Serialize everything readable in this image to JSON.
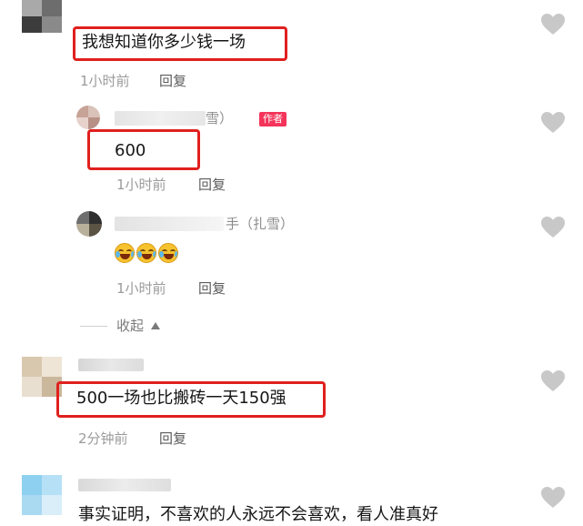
{
  "colors": {
    "highlight_box": "#e0201e",
    "author_badge": "#f4345a",
    "heart": "#c8c8c8",
    "meta_text": "#9b9b9b"
  },
  "comments": [
    {
      "text": "我想知道你多少钱一场",
      "time": "1小时前",
      "reply_label": "回复"
    },
    {
      "name_visible": "雪）",
      "author_badge": "作者",
      "text": "600",
      "time": "1小时前",
      "reply_label": "回复"
    },
    {
      "name_visible": "手（扎雪）",
      "emoji_text": "🤣🤣🤣",
      "time": "1小时前",
      "reply_label": "回复"
    },
    {
      "text": "500一场也比搬砖一天150强",
      "time": "2分钟前",
      "reply_label": "回复"
    },
    {
      "text": "事实证明，不喜欢的人永远不会喜欢，看人准真好"
    }
  ],
  "collapse_label": "收起",
  "collapse_icon": "triangle-up-icon",
  "like_icon": "heart-icon"
}
